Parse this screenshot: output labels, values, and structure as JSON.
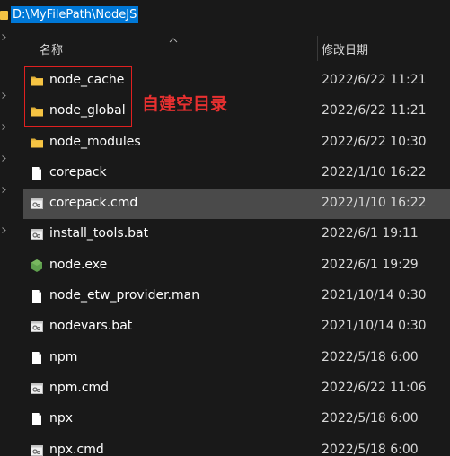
{
  "address_bar": {
    "path": "D:\\MyFilePath\\NodeJS"
  },
  "columns": {
    "name": "名称",
    "date_modified": "修改日期"
  },
  "files": [
    {
      "name": "node_cache",
      "date": "2022/6/22 11:21",
      "icon": "folder-icon"
    },
    {
      "name": "node_global",
      "date": "2022/6/22 11:21",
      "icon": "folder-icon"
    },
    {
      "name": "node_modules",
      "date": "2022/6/22 10:30",
      "icon": "folder-icon"
    },
    {
      "name": "corepack",
      "date": "2022/1/10 16:22",
      "icon": "file-icon"
    },
    {
      "name": "corepack.cmd",
      "date": "2022/1/10 16:22",
      "icon": "script-icon"
    },
    {
      "name": "install_tools.bat",
      "date": "2022/6/1 19:11",
      "icon": "script-icon"
    },
    {
      "name": "node.exe",
      "date": "2022/6/1 19:29",
      "icon": "nodejs-icon"
    },
    {
      "name": "node_etw_provider.man",
      "date": "2021/10/14 0:30",
      "icon": "file-icon"
    },
    {
      "name": "nodevars.bat",
      "date": "2021/10/14 0:30",
      "icon": "script-icon"
    },
    {
      "name": "npm",
      "date": "2022/5/18 6:00",
      "icon": "file-icon"
    },
    {
      "name": "npm.cmd",
      "date": "2022/6/22 11:06",
      "icon": "script-icon"
    },
    {
      "name": "npx",
      "date": "2022/5/18 6:00",
      "icon": "file-icon"
    },
    {
      "name": "npx.cmd",
      "date": "2022/5/18 6:00",
      "icon": "script-icon"
    }
  ],
  "selected_row": 4,
  "annotation": {
    "text": "自建空目录",
    "color": "#e02020"
  },
  "colors": {
    "background": "#191919",
    "selection": "#4a4a4a",
    "address_highlight": "#0078d7",
    "folder": "#f6c443"
  }
}
